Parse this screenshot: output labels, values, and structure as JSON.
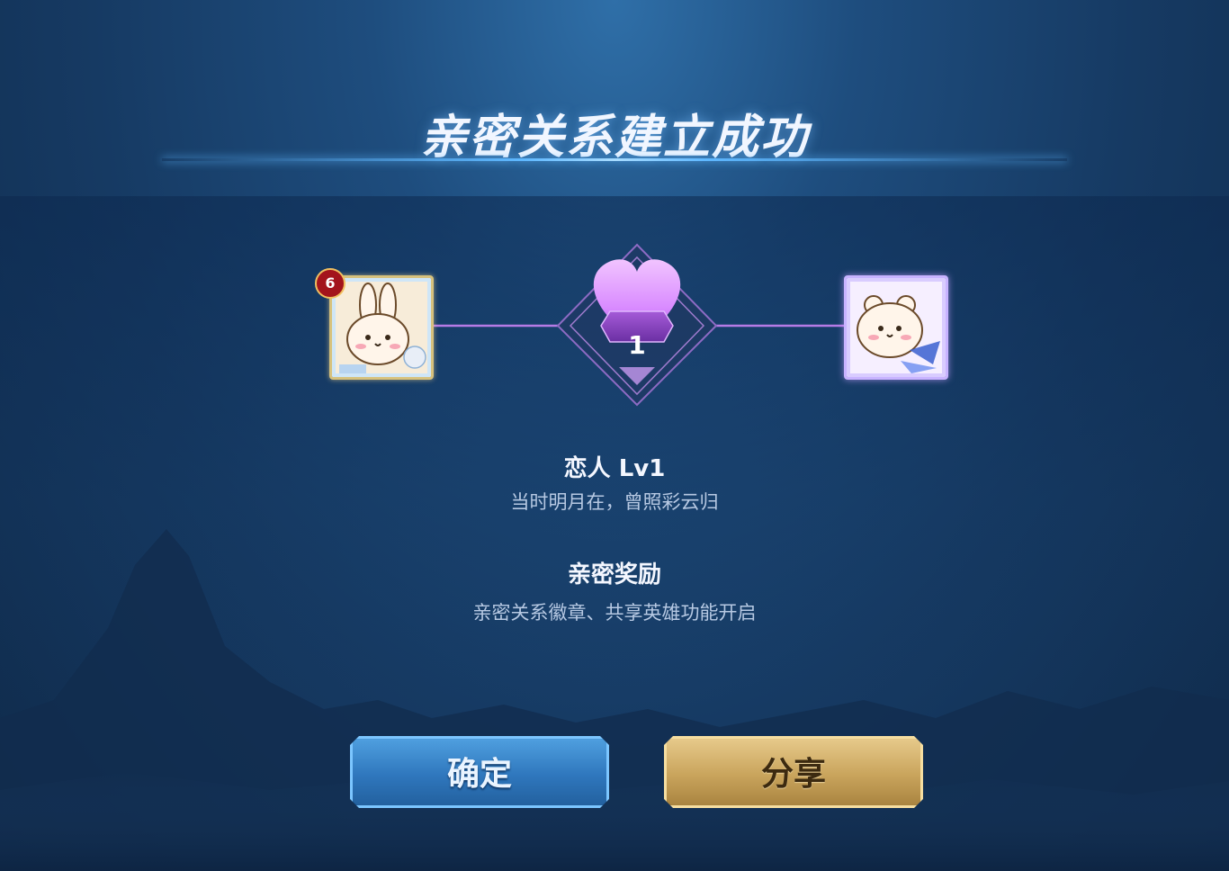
{
  "header": {
    "title": "亲密关系建立成功"
  },
  "players": {
    "left": {
      "level": "6",
      "avatar": "bunny-avatar"
    },
    "right": {
      "avatar": "bear-avatar"
    }
  },
  "intimacy": {
    "level": "1",
    "icon": "heart-icon"
  },
  "relation": {
    "title": "恋人 Lv1",
    "poem": "当时明月在，曾照彩云归"
  },
  "reward": {
    "title": "亲密奖励",
    "description": "亲密关系徽章、共享英雄功能开启"
  },
  "buttons": {
    "confirm": "确定",
    "share": "分享"
  },
  "colors": {
    "accent": "#5fb8ff",
    "heart": "#d98bff",
    "confirm": "#2f77bd",
    "share": "#c9a45c"
  }
}
